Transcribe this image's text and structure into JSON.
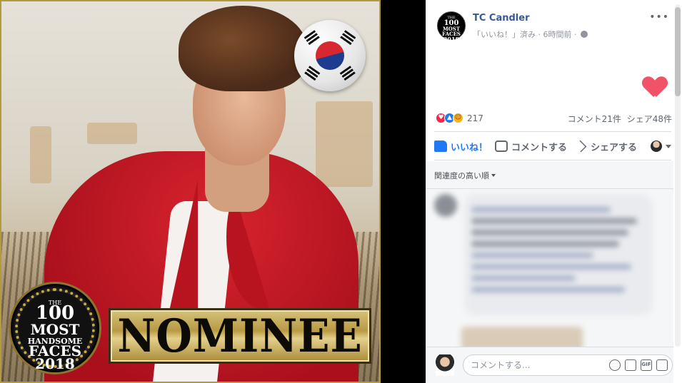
{
  "photo": {
    "badge": {
      "the": "THE",
      "number": "100",
      "most": "MOST",
      "handsome": "HANDSOME",
      "faces": "FACES",
      "year": "2018"
    },
    "nominee_label": "NOMINEE",
    "flag": "south-korea-flag"
  },
  "post": {
    "page_name": "TC Candler",
    "avatar_badge": {
      "number": "100",
      "most": "MOST",
      "faces": "FACES",
      "year": "2018"
    },
    "meta": "「いいね！」済み · 6時間前 ·",
    "reaction_count": "217",
    "comments": "コメント21件",
    "shares": "シェア48件",
    "actions": {
      "like": "いいね！",
      "comment": "コメントする",
      "share": "シェアする"
    },
    "sort_label": "関連度の高い順",
    "composer_placeholder": "コメントする..."
  },
  "colors": {
    "link_blue": "#365899",
    "like_blue": "#2078f4",
    "heart": "#f25268",
    "nominee_gold": "#b99a44"
  }
}
